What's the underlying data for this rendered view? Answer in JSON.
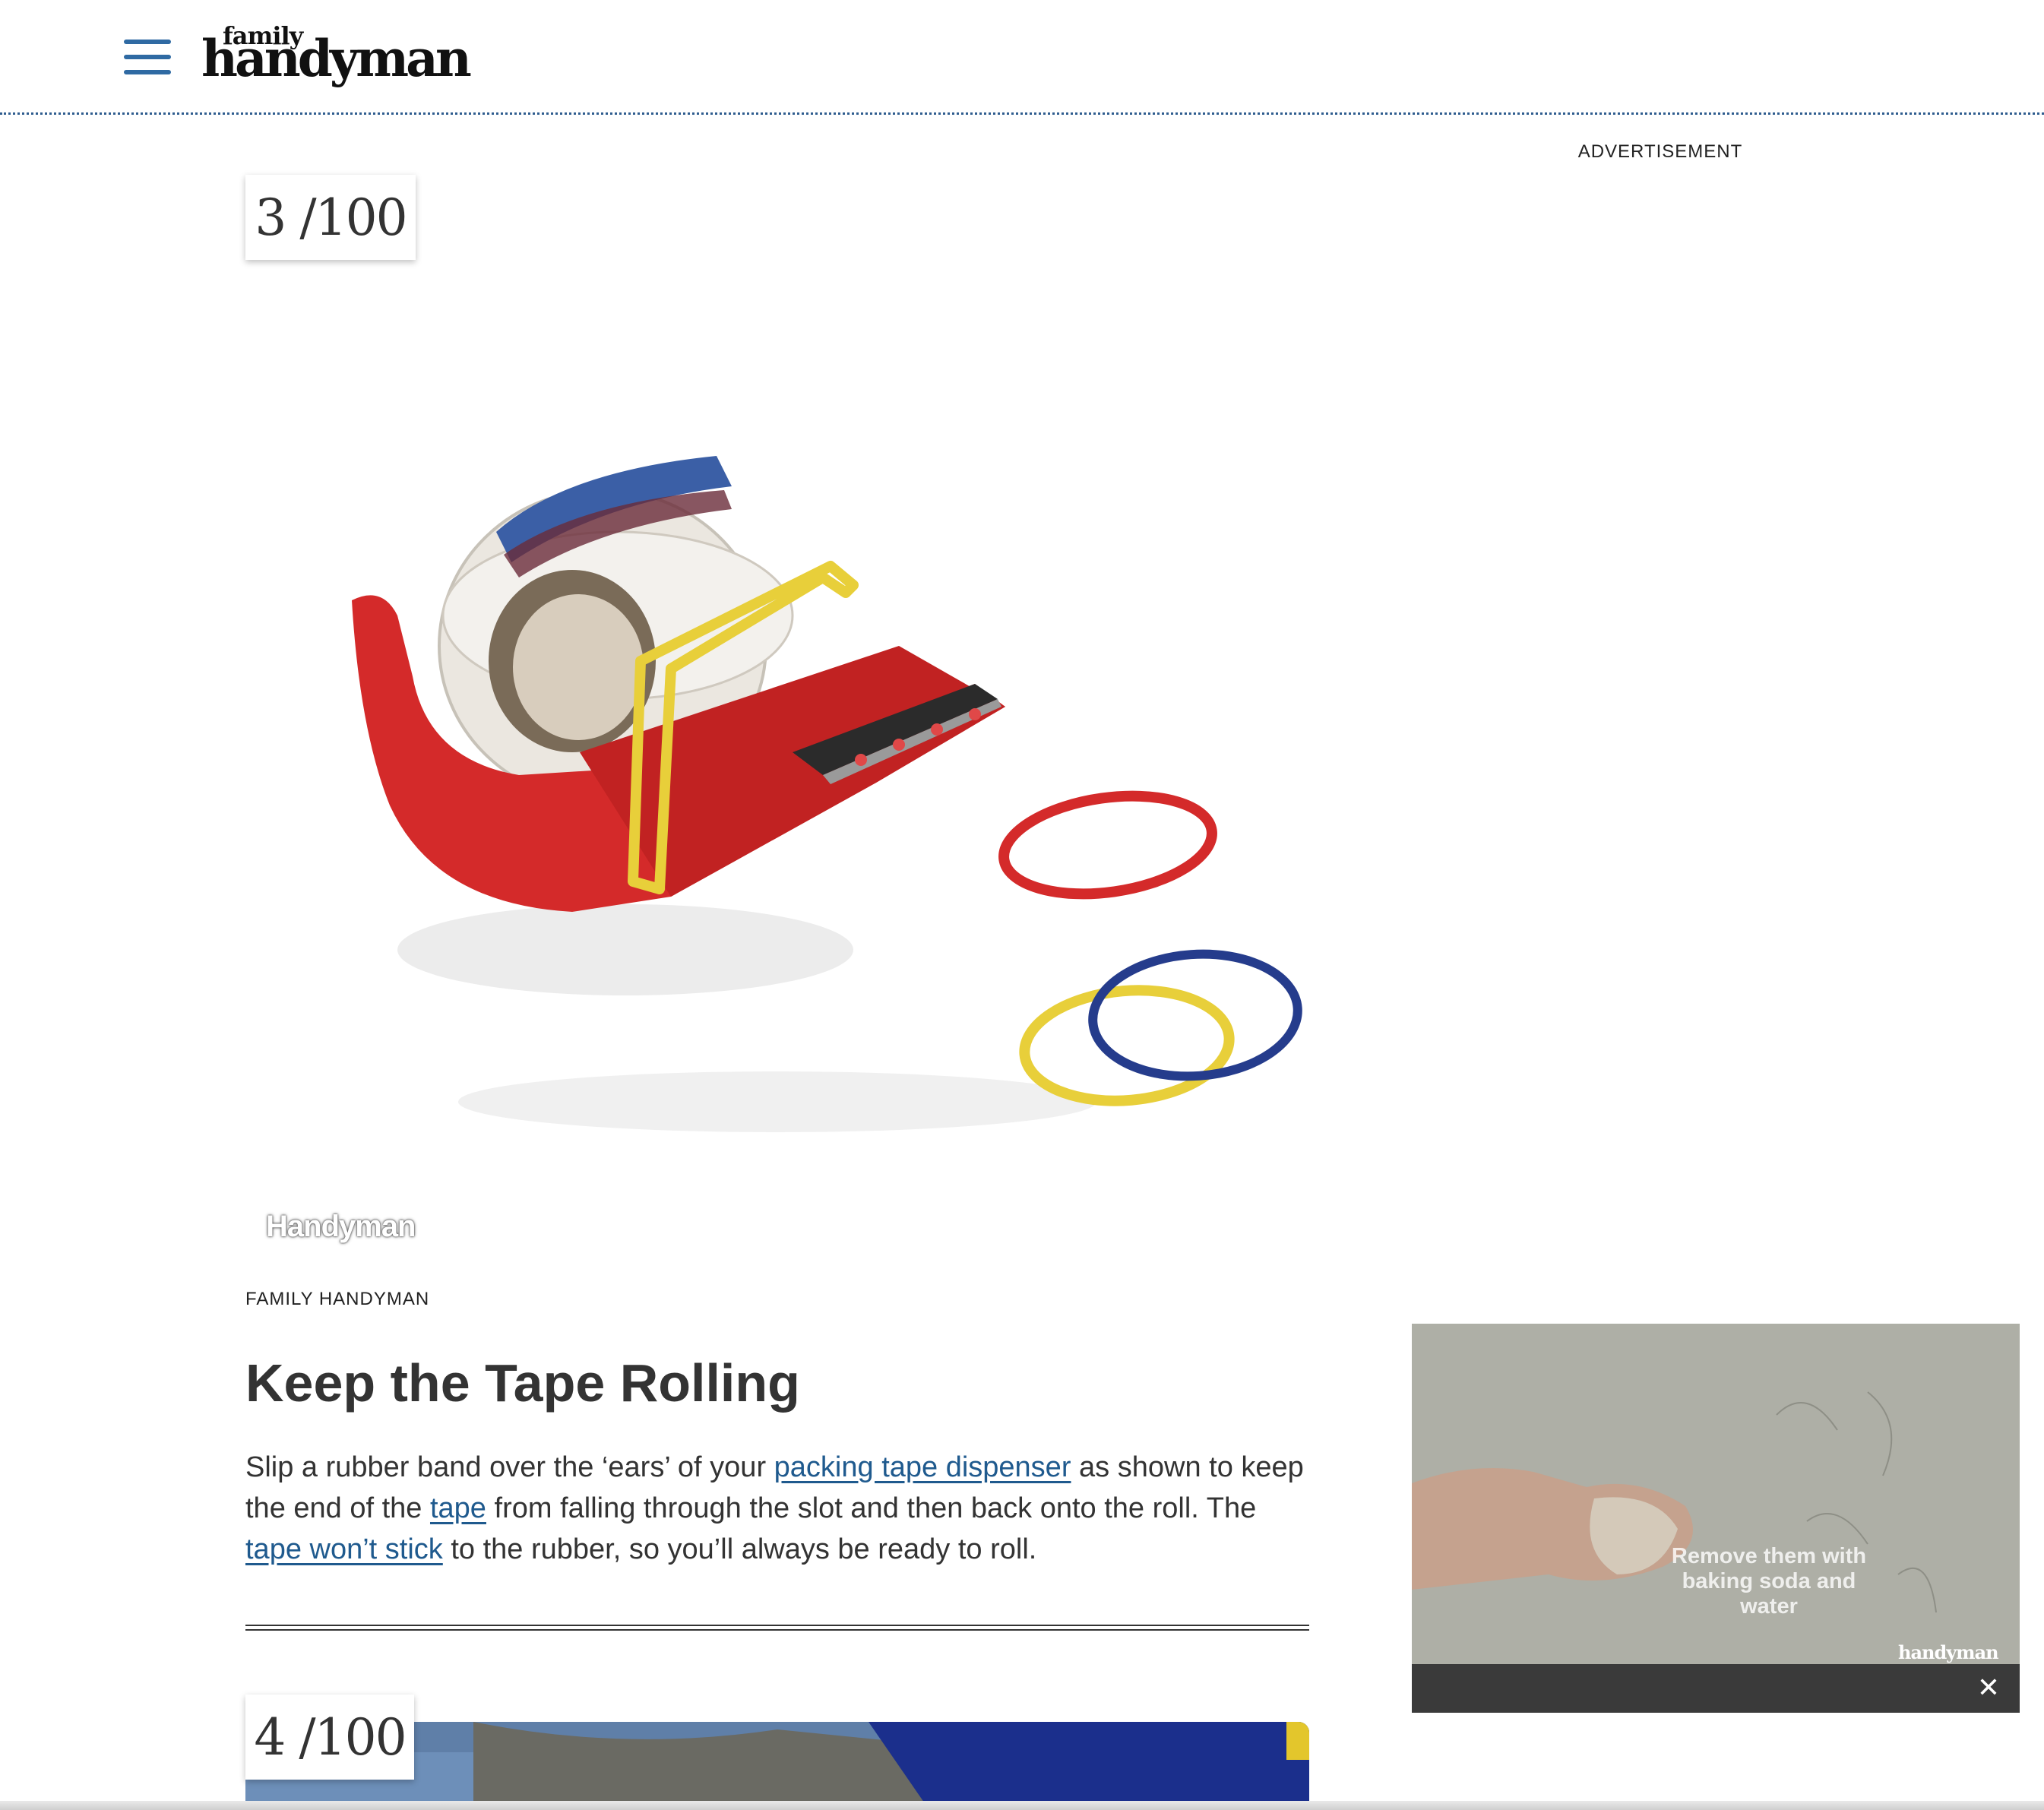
{
  "header": {
    "logo_small": "family",
    "logo_big": "handyman",
    "menu_icon": "hamburger-menu-icon"
  },
  "advertisement_label": "ADVERTISEMENT",
  "slide": {
    "counter": "3 /100",
    "image_watermark": "Handyman",
    "credit": "FAMILY HANDYMAN",
    "title": "Keep the Tape Rolling",
    "body_1": "Slip a rubber band over the ‘ears’ of your ",
    "link_1": "packing tape dispenser",
    "body_2": " as shown to keep the end of the ",
    "link_2": "tape",
    "body_3": " from falling through the slot and then back onto the roll. The",
    "link_3": " tape won’t stick",
    "body_4": " to the rubber, so you’ll always be ready to roll."
  },
  "next_slide": {
    "counter": "4 /100"
  },
  "video": {
    "caption": "Remove them with baking soda and water",
    "logo": "handyman",
    "close_label": "✕",
    "close_icon": "close-icon"
  },
  "colors": {
    "link": "#1f5a8e",
    "menu": "#2f6aa3",
    "dispenser_red": "#d42a2a",
    "band_yellow": "#e8cf3a",
    "band_blue": "#253c8c"
  }
}
